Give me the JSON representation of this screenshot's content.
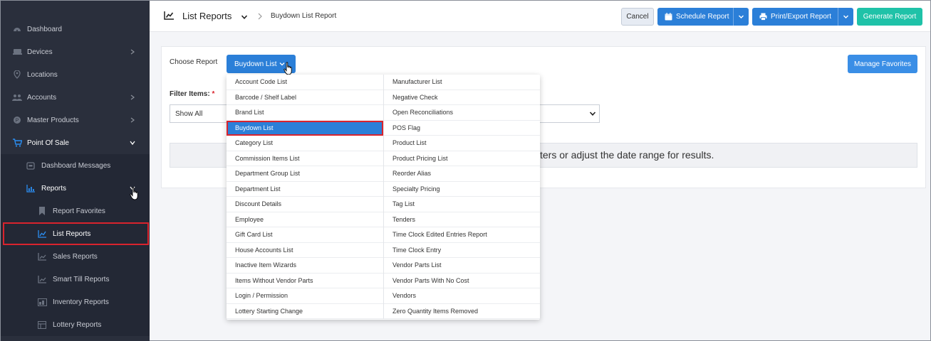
{
  "sidebar": {
    "items": [
      {
        "label": "Dashboard",
        "icon": "dashboard-icon",
        "chevron": false
      },
      {
        "label": "Devices",
        "icon": "devices-icon",
        "chevron": true
      },
      {
        "label": "Locations",
        "icon": "location-icon",
        "chevron": false
      },
      {
        "label": "Accounts",
        "icon": "accounts-icon",
        "chevron": true
      },
      {
        "label": "Master Products",
        "icon": "products-icon",
        "chevron": true
      },
      {
        "label": "Point Of Sale",
        "icon": "cart-icon",
        "chevron": true
      }
    ],
    "pos_sub": [
      {
        "label": "Dashboard Messages",
        "icon": "messages-icon"
      },
      {
        "label": "Reports",
        "icon": "chart-icon"
      }
    ],
    "reports_sub": [
      {
        "label": "Report Favorites",
        "icon": "bookmark-icon"
      },
      {
        "label": "List Reports",
        "icon": "line-chart-icon"
      },
      {
        "label": "Sales Reports",
        "icon": "bar-chart-icon"
      },
      {
        "label": "Smart Till Reports",
        "icon": "bar-chart-icon"
      },
      {
        "label": "Inventory Reports",
        "icon": "inventory-icon"
      },
      {
        "label": "Lottery Reports",
        "icon": "lottery-icon"
      }
    ]
  },
  "header": {
    "title": "List Reports",
    "breadcrumb": "Buydown List Report",
    "cancel": "Cancel",
    "schedule": "Schedule Report",
    "print_export": "Print/Export Report",
    "generate": "Generate Report"
  },
  "main": {
    "choose_label": "Choose Report",
    "choose_value": "Buydown List",
    "manage_favorites": "Manage Favorites",
    "filter_label": "Filter Items:",
    "filter_required": "*",
    "filter_value": "Show All",
    "message": "ters or adjust the date range for results."
  },
  "dropdown": {
    "selected": "Buydown List",
    "left": [
      "Account Code List",
      "Barcode / Shelf Label",
      "Brand List",
      "Buydown List",
      "Category List",
      "Commission Items List",
      "Department Group List",
      "Department List",
      "Discount Details",
      "Employee",
      "Gift Card List",
      "House Accounts List",
      "Inactive Item Wizards",
      "Items Without Vendor Parts",
      "Login / Permission",
      "Lottery Starting Change"
    ],
    "right": [
      "Manufacturer List",
      "Negative Check",
      "Open Reconciliations",
      "POS Flag",
      "Product List",
      "Product Pricing List",
      "Reorder Alias",
      "Specialty Pricing",
      "Tag List",
      "Tenders",
      "Time Clock Edited Entries Report",
      "Time Clock Entry",
      "Vendor Parts List",
      "Vendor Parts With No Cost",
      "Vendors",
      "Zero Quantity Items Removed"
    ]
  },
  "colors": {
    "sidebar_bg": "#2a2f3c",
    "primary": "#2b7fd8",
    "teal": "#1fc2a8",
    "highlight": "#d9232d"
  }
}
